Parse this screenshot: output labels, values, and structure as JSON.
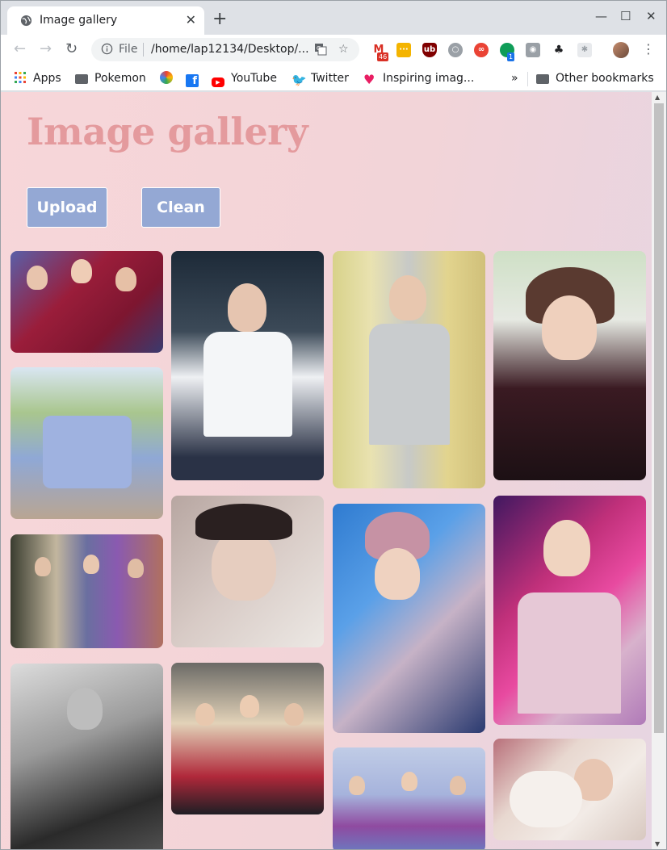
{
  "browser": {
    "tab_title": "Image gallery",
    "tab_close": "✕",
    "new_tab": "+",
    "minimize": "—",
    "maximize": "☐",
    "close": "✕",
    "back": "←",
    "forward": "→",
    "reload": "↻",
    "url_scheme": "File",
    "url": "/home/lap12134/Desktop/...",
    "gmail_badge": "46",
    "ext_badge": "1",
    "menu": "⋮"
  },
  "bookmarks": {
    "apps": "Apps",
    "pokemon": "Pokemon",
    "youtube": "YouTube",
    "twitter": "Twitter",
    "inspiring": "Inspiring imag...",
    "overflow": "»",
    "other": "Other bookmarks"
  },
  "page": {
    "title": "Image gallery",
    "upload_label": "Upload",
    "clean_label": "Clean"
  },
  "colors": {
    "title": "#e49a9d",
    "button": "#94a8d4",
    "background": "#f4d6d9"
  }
}
